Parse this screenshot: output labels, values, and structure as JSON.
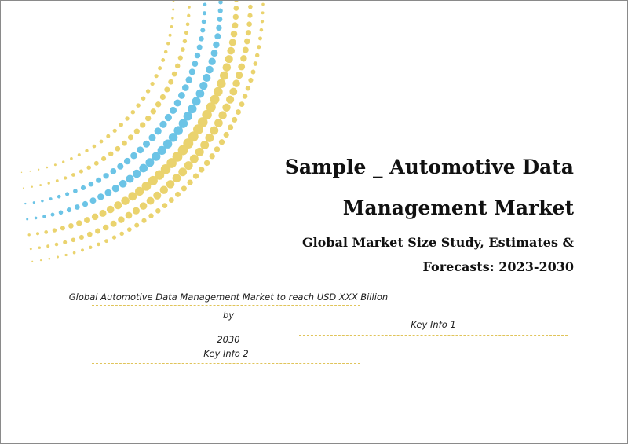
{
  "report": {
    "title_line_1": "Sample _ Automotive Data",
    "title_line_2": "Management Market",
    "subtitle_line_1": "Global Market Size Study, Estimates &",
    "subtitle_line_2": "Forecasts: 2023-2030"
  },
  "info": {
    "main_line_1": "Global Automotive Data Management Market to reach USD XXX Billion by",
    "main_line_2": "2030",
    "key_info_1": "Key Info 1",
    "key_info_2": "Key Info 2"
  },
  "colors": {
    "dot_blue": "#6cc4e6",
    "dot_yellow": "#ead36e",
    "divider": "#e0c45a"
  }
}
